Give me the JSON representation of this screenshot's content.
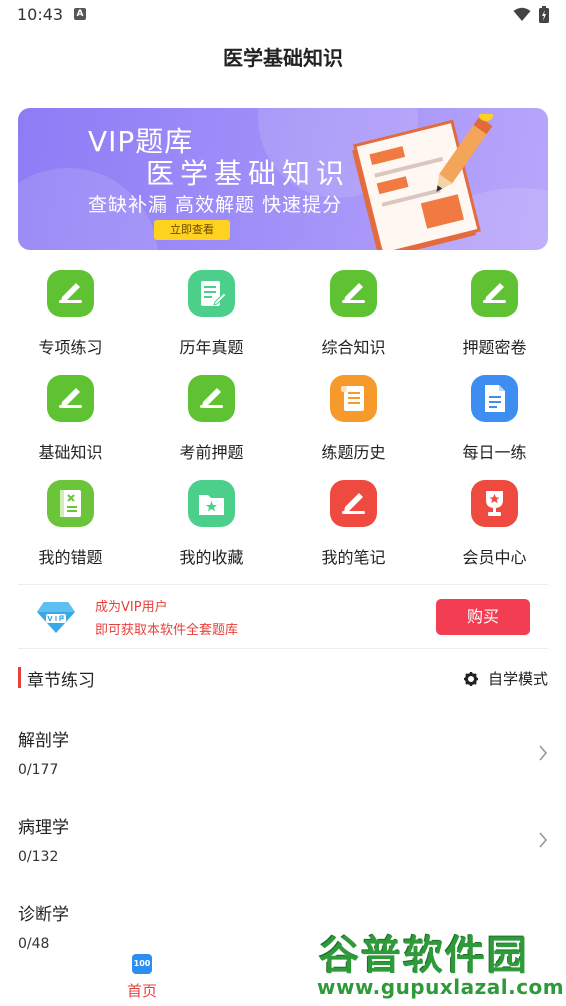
{
  "status_bar": {
    "time": "10:43",
    "notif_icon": "A"
  },
  "app_bar": {
    "title": "医学基础知识"
  },
  "banner": {
    "line1": "VIP题库",
    "line2": "医学基础知识",
    "line3": "查缺补漏 高效解题 快速提分",
    "button": "立即查看"
  },
  "grid": [
    {
      "label": "专项练习",
      "icon": "exam-pen-icon",
      "color": "#5ec232"
    },
    {
      "label": "历年真题",
      "icon": "note-edit-icon",
      "color": "#4ccf8a"
    },
    {
      "label": "综合知识",
      "icon": "exam-pen-icon",
      "color": "#5ec232"
    },
    {
      "label": "押题密卷",
      "icon": "exam-pen-icon",
      "color": "#5ec232"
    },
    {
      "label": "基础知识",
      "icon": "exam-pen-icon",
      "color": "#5ec232"
    },
    {
      "label": "考前押题",
      "icon": "exam-pen-icon",
      "color": "#5ec232"
    },
    {
      "label": "练题历史",
      "icon": "scroll-icon",
      "color": "#f79a2c"
    },
    {
      "label": "每日一练",
      "icon": "document-icon",
      "color": "#3d8ef0"
    },
    {
      "label": "我的错题",
      "icon": "error-book-icon",
      "color": "#6cc43a"
    },
    {
      "label": "我的收藏",
      "icon": "star-folder-icon",
      "color": "#4ccf8a"
    },
    {
      "label": "我的笔记",
      "icon": "note-pen-icon",
      "color": "#ef4a3f"
    },
    {
      "label": "会员中心",
      "icon": "trophy-icon",
      "color": "#ef4a3f"
    }
  ],
  "vip": {
    "line1": "成为VIP用户",
    "line2": "即可获取本软件全套题库",
    "buy": "购买"
  },
  "section": {
    "title": "章节练习",
    "mode": "自学模式"
  },
  "chapters": [
    {
      "name": "解剖学",
      "progress": "0/177"
    },
    {
      "name": "病理学",
      "progress": "0/132"
    },
    {
      "name": "诊断学",
      "progress": "0/48"
    }
  ],
  "tabbar": {
    "home_icon_text": "100",
    "home": "首页"
  },
  "watermark": {
    "cn": "谷普软件园",
    "url": "www.gupuxlazal.com"
  }
}
